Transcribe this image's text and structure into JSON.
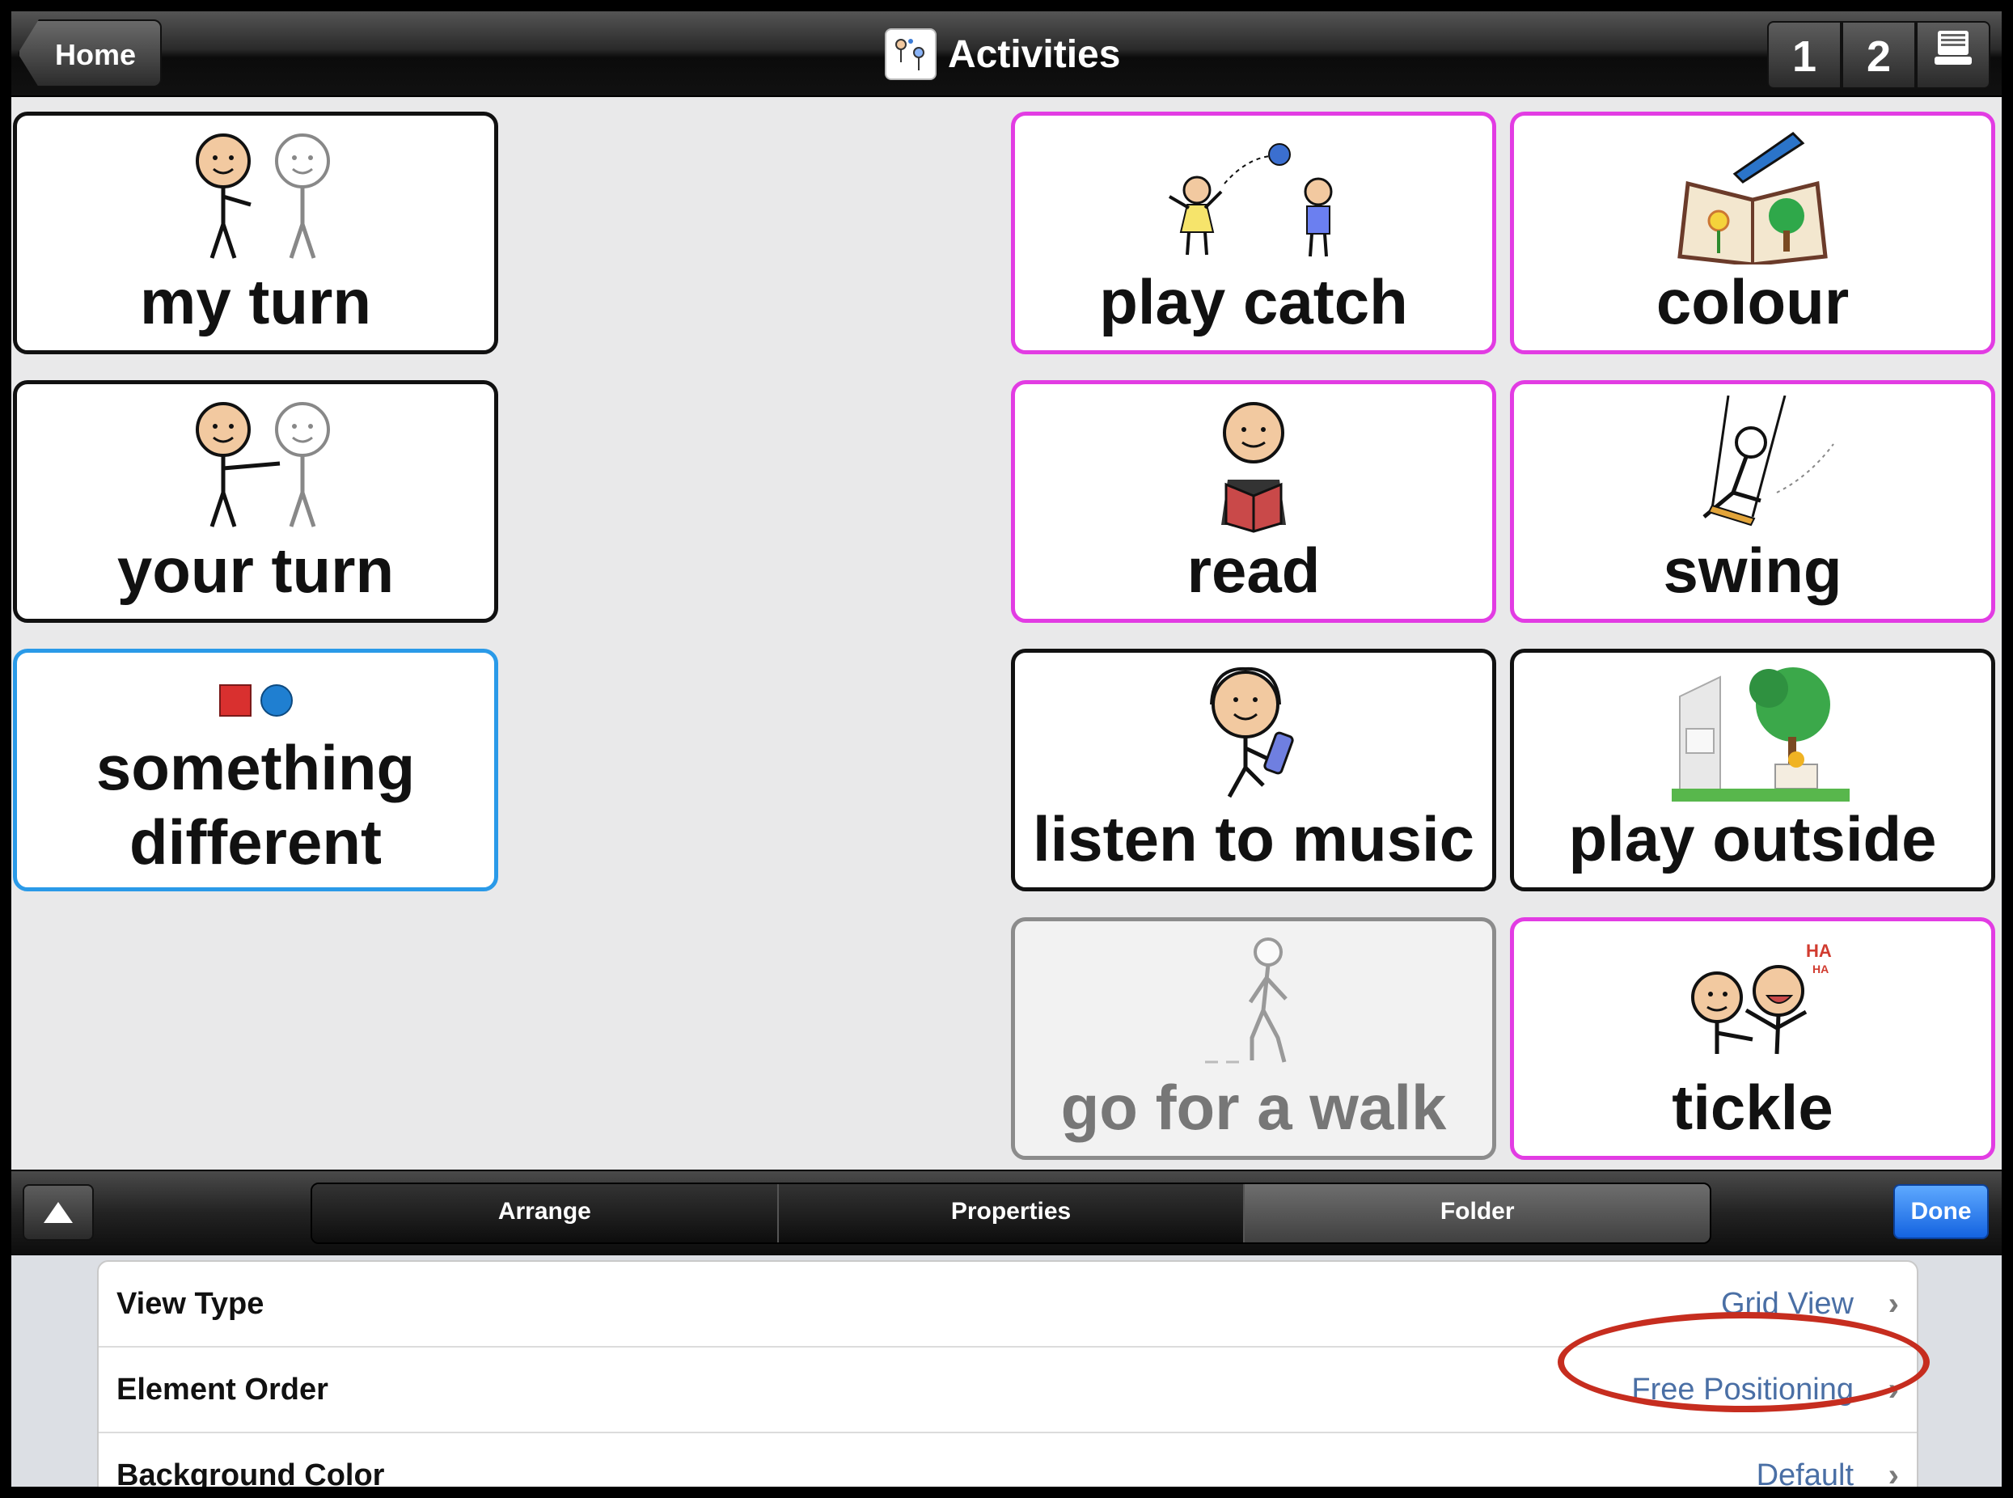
{
  "app": {
    "title": "Activities",
    "home_label": "Home",
    "pages": [
      "1",
      "2"
    ]
  },
  "cells": [
    {
      "label": "my turn",
      "border": "#111111"
    },
    {
      "label": "your turn",
      "border": "#111111"
    },
    {
      "label": "something different",
      "border": "#2a9ae8"
    },
    {
      "label": "play catch",
      "border": "#e23ce3"
    },
    {
      "label": "colour",
      "border": "#e23ce3"
    },
    {
      "label": "read",
      "border": "#e23ce3"
    },
    {
      "label": "swing",
      "border": "#e23ce3"
    },
    {
      "label": "listen to music",
      "border": "#111111"
    },
    {
      "label": "play outside",
      "border": "#111111"
    },
    {
      "label": "go for a walk",
      "border": "#8c8c8c"
    },
    {
      "label": "tickle",
      "border": "#e23ce3"
    }
  ],
  "toolbar": {
    "tabs": [
      "Arrange",
      "Properties",
      "Folder"
    ],
    "selected_tab": "Folder",
    "done_label": "Done"
  },
  "settings": [
    {
      "label": "View Type",
      "value": "Grid View"
    },
    {
      "label": "Element Order",
      "value": "Free Positioning"
    },
    {
      "label": "Background Color",
      "value": "Default"
    }
  ],
  "annotation": {
    "target": "Free Positioning",
    "color": "#c62d1f"
  }
}
